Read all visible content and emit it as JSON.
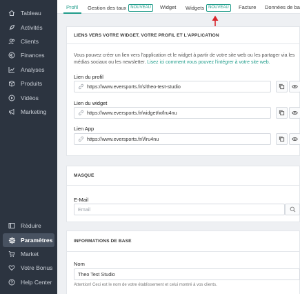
{
  "sidebar": {
    "items": [
      {
        "label": "Tableau",
        "icon": "home-icon"
      },
      {
        "label": "Activités",
        "icon": "rocket-icon"
      },
      {
        "label": "Clients",
        "icon": "users-icon"
      },
      {
        "label": "Finances",
        "icon": "euro-icon"
      },
      {
        "label": "Analyses",
        "icon": "chart-icon"
      },
      {
        "label": "Produits",
        "icon": "box-icon"
      },
      {
        "label": "Vidéos",
        "icon": "play-icon"
      },
      {
        "label": "Marketing",
        "icon": "megaphone-icon"
      }
    ],
    "bottom": [
      {
        "label": "Réduire",
        "icon": "collapse-icon"
      },
      {
        "label": "Paramètres",
        "icon": "gear-icon"
      },
      {
        "label": "Market",
        "icon": "cart-icon"
      },
      {
        "label": "Votre Bonus",
        "icon": "heart-icon"
      },
      {
        "label": "Help Center",
        "icon": "help-icon"
      }
    ]
  },
  "tabs": {
    "profil": "Profil",
    "gestion": "Gestion des taux",
    "gestion_badge": "NOUVEAU",
    "widget": "Widget",
    "widgets": "Widgets",
    "widgets_badge": "NOUVEAU",
    "facture": "Facture",
    "donnees": "Données de bas"
  },
  "links_card": {
    "title": "LIENS VERS VOTRE WIDGET, VOTRE PROFIL ET L'APPLICATION",
    "desc_line1": "Vous pouvez créer un lien vers l'application et le widget à partir de votre site web ou les partager via les",
    "desc_line2_a": "médias sociaux ou les newsletter. ",
    "desc_line2_link": "Lisez ici comment vous pouvez l'intégrer à votre site web.",
    "profile_label": "Lien du profil",
    "profile_url": "https://www.eversports.fr/s/theo-test-studio",
    "widget_label": "Lien du widget",
    "widget_url": "https://www.eversports.fr/widget/w/lru4nu",
    "app_label": "Lien App",
    "app_url": "https://www.eversports.fr/i/lru4nu"
  },
  "mask_card": {
    "title": "MASQUE",
    "email_label": "E-Mail",
    "email_placeholder": "Email"
  },
  "base_card": {
    "title": "INFORMATIONS DE BASE",
    "name_label": "Nom",
    "name_value": "Theo Test Studio",
    "name_help": "Attention! Ceci est le nom de votre établissement et celui montré à vos clients."
  },
  "colors": {
    "accent": "#1f9c8a",
    "sidebar": "#2c3440",
    "arrow": "#d9252b"
  }
}
